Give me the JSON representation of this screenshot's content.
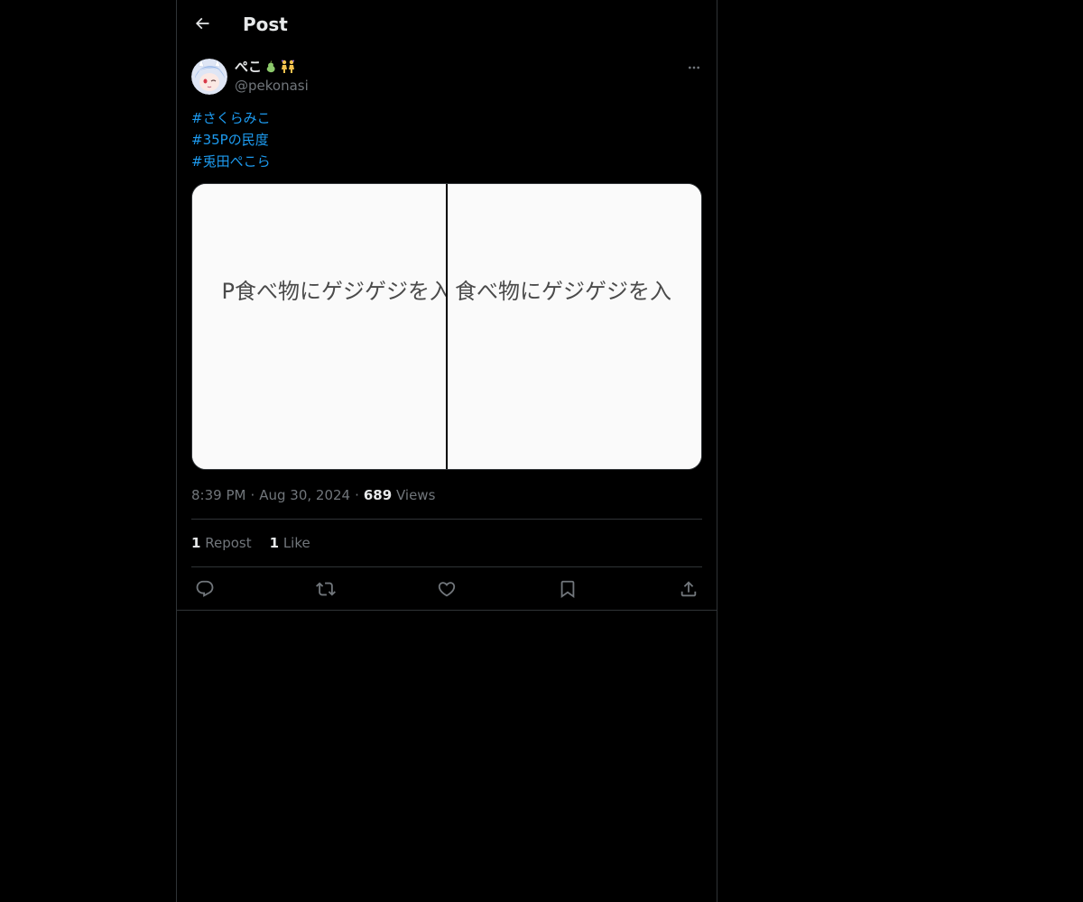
{
  "header": {
    "title": "Post",
    "back_icon": "arrow-left-icon"
  },
  "author": {
    "display_name": "ぺこ",
    "badges": [
      "pear-emoji",
      "dancers-emoji"
    ],
    "handle": "@pekonasi"
  },
  "tweet": {
    "hashtags": [
      "#さくらみこ",
      "#35Pの民度",
      "#兎田ぺこら"
    ],
    "media": {
      "left_caption": "P食べ物にゲジゲジを入",
      "right_caption": "食べ物にゲジゲジを入"
    },
    "time": "8:39 PM",
    "separator": "·",
    "date": "Aug 30, 2024",
    "views_count": "689",
    "views_label": "Views"
  },
  "stats": {
    "repost_count": "1",
    "repost_label": "Repost",
    "like_count": "1",
    "like_label": "Like"
  },
  "actions": [
    "reply-icon",
    "repost-icon",
    "like-icon",
    "bookmark-icon",
    "share-icon"
  ],
  "colors": {
    "background": "#000000",
    "text": "#e7e9ea",
    "muted": "#71767b",
    "link": "#1d9bf0",
    "border": "#2f3336"
  }
}
